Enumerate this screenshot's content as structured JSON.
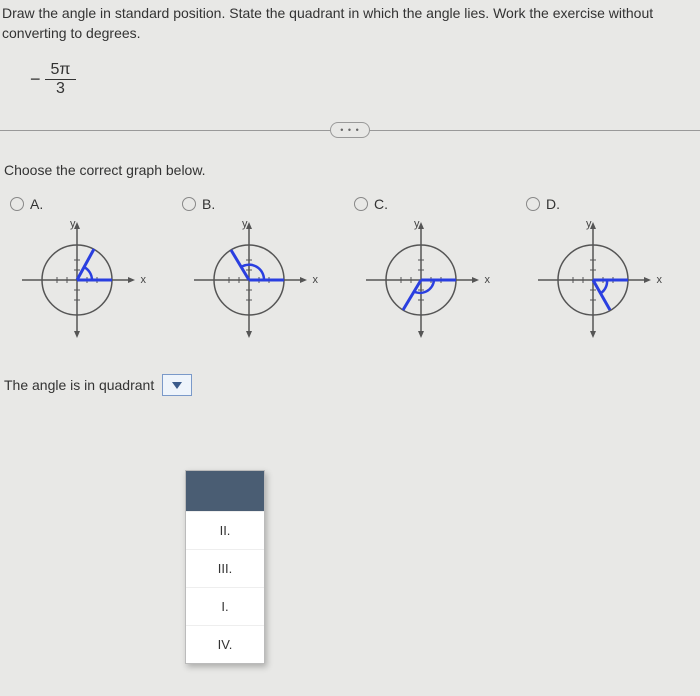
{
  "question": {
    "text": "Draw the angle in standard position. State the quadrant in which the angle lies. Work the exercise without converting to degrees.",
    "angle": {
      "sign": "−",
      "numerator": "5π",
      "denominator": "3"
    }
  },
  "divider": {
    "pill": "• • •"
  },
  "prompt": "Choose the correct graph below.",
  "options": [
    {
      "label": "A.",
      "ylab": "y",
      "xlab": "x"
    },
    {
      "label": "B.",
      "ylab": "y",
      "xlab": "x"
    },
    {
      "label": "C.",
      "ylab": "y",
      "xlab": "x"
    },
    {
      "label": "D.",
      "ylab": "y",
      "xlab": "x"
    }
  ],
  "quadrant": {
    "label": "The angle is in quadrant",
    "selected": "",
    "menu": [
      "",
      "II.",
      "III.",
      "I.",
      "IV."
    ]
  }
}
